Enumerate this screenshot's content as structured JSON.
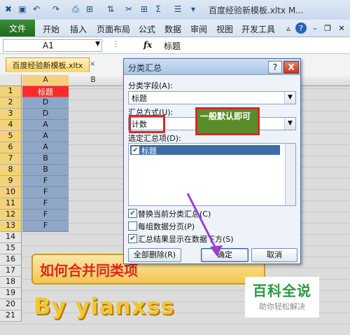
{
  "window": {
    "title": "百度经验新模板.xltx M..."
  },
  "ribbon": {
    "file_tab": "文件",
    "tabs": [
      "开始",
      "插入",
      "页面布局",
      "公式",
      "数据",
      "审阅",
      "视图",
      "开发工具"
    ]
  },
  "formula_bar": {
    "name_box": "A1",
    "fx": "fx",
    "formula": "标题"
  },
  "workbook_tab": {
    "label": "百度经验新模板.xltx",
    "close": "×"
  },
  "sheet": {
    "columns": [
      "A",
      "B"
    ],
    "row_numbers": [
      "1",
      "2",
      "3",
      "4",
      "5",
      "6",
      "7",
      "8",
      "9",
      "10",
      "11",
      "12",
      "13",
      "14",
      "15",
      "16",
      "17",
      "18",
      "19",
      "20",
      "21"
    ],
    "column_a_values": [
      "标题",
      "D",
      "D",
      "A",
      "A",
      "A",
      "B",
      "B",
      "F",
      "F",
      "F",
      "F",
      "F"
    ]
  },
  "overlay": {
    "banner_text": "如何合并同类项",
    "by_text": "By  yianxss"
  },
  "dialog": {
    "title": "分类汇总",
    "help": "?",
    "close": "X",
    "group_by_label": "分类字段(A):",
    "group_by_value": "标题",
    "function_label": "汇总方式(U):",
    "function_value": "计数",
    "items_label": "选定汇总项(D):",
    "items": [
      "标题"
    ],
    "options": [
      {
        "label": "替换当前分类汇总(C)",
        "checked": true
      },
      {
        "label": "每组数据分页(P)",
        "checked": false
      },
      {
        "label": "汇总结果显示在数据下方(S)",
        "checked": true
      }
    ],
    "remove_all_button": "全部删除(R)",
    "ok_button": "确定",
    "cancel_button": "取消"
  },
  "annotation": {
    "note": "一般默认即可"
  },
  "logo": {
    "main": "百科全说",
    "sub": "助你轻松解决"
  }
}
